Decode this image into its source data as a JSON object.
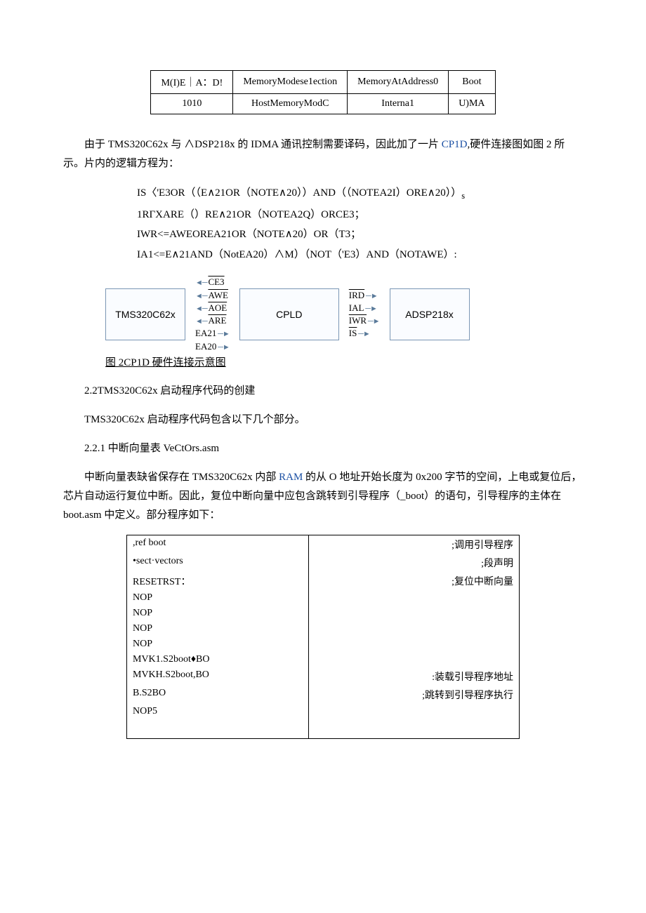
{
  "modetable": {
    "headers": [
      "M(I)E｜A：D!",
      "MemoryModese1ection",
      "MemoryAtAddress0",
      "Boot"
    ],
    "row": [
      "1010",
      "HostMemoryModC",
      "Interna1",
      "U)MA"
    ]
  },
  "para1_a": "由于 TMS320C62x 与 ∧DSP218x 的 IDMA 通讯控制需要译码，因此加了一片",
  "para1_link": "CP1D",
  "para1_b": ",硬件连接图如图 2 所示。片内的逻辑方程为：",
  "eq1": "IS〈'E3OR（（E∧21OR（NOTE∧20））AND（（NOTEA2I）ORE∧20））",
  "eq1_sub": "s",
  "eq2": "1RΓXARE（）RE∧21OR（NOTEA2Q）ORCE3；",
  "eq3": "IWR<=AWEOREA21OR（NOTE∧20）OR（T3；",
  "eq4": "IA1<=E∧21AND（NotEA20）∧M）（NOT（'E3）AND（NOTAWE）:",
  "diagram": {
    "left_box": "TMS320C62x",
    "mid_box": "CPLD",
    "right_box": "ADSP218x",
    "left_sigs": [
      "CE3",
      "AWE",
      "AOE",
      "ARE",
      "EA21",
      "EA20"
    ],
    "right_sigs": [
      "IRD",
      "IAL",
      "IWR",
      "IS"
    ]
  },
  "caption": "图 2CP1D 硬件连接示意图",
  "h22": "2.2TMS320C62x 启动程序代码的创建",
  "p22": "TMS320C62x 启动程序代码包含以下几个部分。",
  "h221": "2.2.1 中断向量表 VeCtOrs.asm",
  "p221_a": "中断向量表缺省保存在 TMS320C62x 内部 ",
  "p221_link": "RAM",
  "p221_b": " 的从 O 地址开始长度为 0x200 字节的空间，上电或复位后，芯片自动运行复位中断。因此，复位中断向量中应包含跳转到引导程序（_boot）的语句，引导程序的主体在 boot.asm 中定义。部分程序如下：",
  "code": [
    {
      "l": ",ref        boot",
      "r": ";调用引导程序"
    },
    {
      "l": "•sect·vectors",
      "r": ";段声明"
    },
    {
      "l": "RESETRST：",
      "r": ";复位中断向量"
    },
    {
      "l": "NOP",
      "r": ""
    },
    {
      "l": "NOP",
      "r": ""
    },
    {
      "l": "NOP",
      "r": ""
    },
    {
      "l": "NOP",
      "r": ""
    },
    {
      "l": "MVK1.S2boot♦BO",
      "r": ""
    },
    {
      "l": "MVKH.S2boot,BO",
      "r": ":装载引导程序地址"
    },
    {
      "l": "B.S2BO",
      "r": ";跳转到引导程序执行"
    },
    {
      "l": "NOP5",
      "r": ""
    }
  ]
}
